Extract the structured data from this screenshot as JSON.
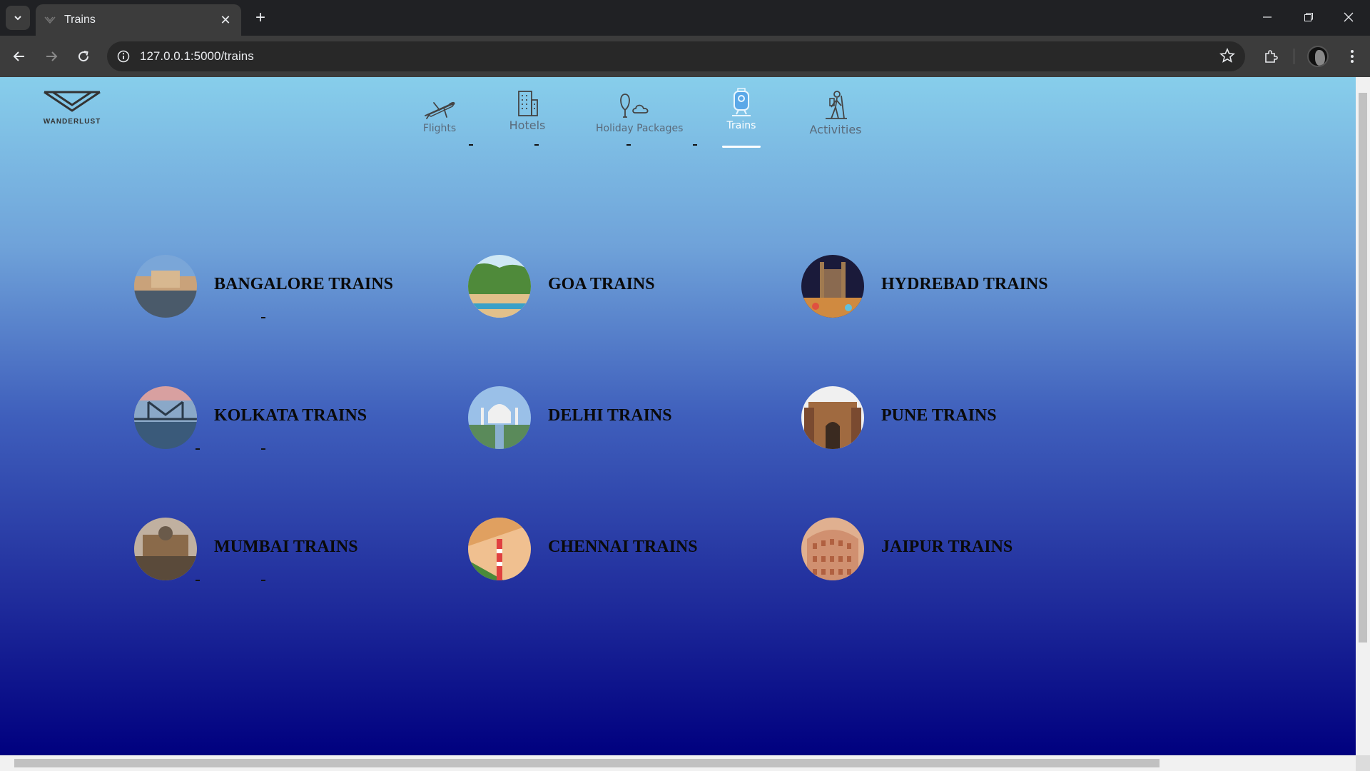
{
  "browser": {
    "tab_title": "Trains",
    "url": "127.0.0.1:5000/trains",
    "close_glyph": "✕",
    "new_tab_glyph": "+"
  },
  "site": {
    "logo_text": "WANDERLUST",
    "nav": [
      {
        "label": "Flights",
        "icon": "airplane-icon",
        "active": false
      },
      {
        "label": "Hotels",
        "icon": "building-icon",
        "active": false
      },
      {
        "label": "Holiday Packages",
        "icon": "balloon-icon",
        "active": false
      },
      {
        "label": "Trains",
        "icon": "train-icon",
        "active": true
      },
      {
        "label": "Activities",
        "icon": "hiker-icon",
        "active": false
      }
    ]
  },
  "cities": [
    {
      "name": "BANGALORE TRAINS",
      "palette": [
        "#7aa6d8",
        "#c9a27a",
        "#4a5a6a"
      ]
    },
    {
      "name": "GOA TRAINS",
      "palette": [
        "#cfe8f5",
        "#4f8a3a",
        "#e2c08a"
      ]
    },
    {
      "name": "HYDREBAD TRAINS",
      "palette": [
        "#1a1a3a",
        "#d08a40",
        "#603040"
      ]
    },
    {
      "name": "KOLKATA TRAINS",
      "palette": [
        "#d8a0a0",
        "#3a5a7a",
        "#8aa8c8"
      ]
    },
    {
      "name": "DELHI TRAINS",
      "palette": [
        "#9ac0e8",
        "#f0f0f0",
        "#5a8a5a"
      ]
    },
    {
      "name": "PUNE TRAINS",
      "palette": [
        "#f0f0f0",
        "#a06a40",
        "#7a4a30"
      ]
    },
    {
      "name": "MUMBAI TRAINS",
      "palette": [
        "#c0b0a0",
        "#8a6a4a",
        "#5a4a3a"
      ]
    },
    {
      "name": "CHENNAI TRAINS",
      "palette": [
        "#f0c090",
        "#e0a060",
        "#4a8a3a"
      ]
    },
    {
      "name": "JAIPUR TRAINS",
      "palette": [
        "#d09070",
        "#b06040",
        "#e0b090"
      ]
    }
  ]
}
